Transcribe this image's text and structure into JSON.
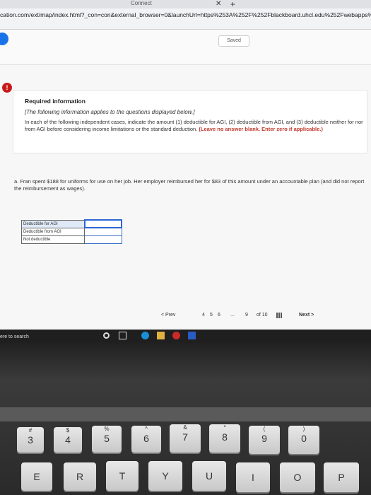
{
  "browser": {
    "tab_title": "Connect",
    "url": "cation.com/ext/map/index.html?_con=con&external_browser=0&launchUrl=https%253A%252F%252Fblackboard.uhcl.edu%252Fwebapps%"
  },
  "toolbar": {
    "saved_label": "Saved"
  },
  "info": {
    "alert_symbol": "!",
    "title": "Required information",
    "subtitle": "[The following information applies to the questions displayed below.]",
    "body": "In each of the following independent cases, indicate the amount (1) deductible for AGI, (2) deductible from AGI, and (3) deductible neither for nor from AGI before considering income limitations or the standard deduction.",
    "emphasis": "(Leave no answer blank. Enter zero if applicable.)"
  },
  "question": {
    "text": "a. Fran spent $188 for uniforms for use on her job. Her employer reimbursed her for $83 of this amount under an accountable plan (and did not report the reimbursement as wages)."
  },
  "answer_table": {
    "rows": [
      {
        "label": "Deductible for AGI",
        "value": ""
      },
      {
        "label": "Deductible from AGI",
        "value": ""
      },
      {
        "label": "Not deductible",
        "value": ""
      }
    ]
  },
  "pager": {
    "prev_label": "< Prev",
    "pages": [
      "4",
      "5",
      "6",
      "...",
      "9"
    ],
    "of_label": "of 10",
    "next_label": "Next >"
  },
  "taskbar": {
    "search_placeholder": "ere to search"
  },
  "keyboard": {
    "number_keys": [
      {
        "sym": "#",
        "main": "3"
      },
      {
        "sym": "$",
        "main": "4"
      },
      {
        "sym": "%",
        "main": "5"
      },
      {
        "sym": "^",
        "main": "6"
      },
      {
        "sym": "&",
        "main": "7"
      },
      {
        "sym": "*",
        "main": "8"
      },
      {
        "sym": "(",
        "main": "9"
      },
      {
        "sym": ")",
        "main": "0"
      }
    ],
    "letter_keys": [
      "E",
      "R",
      "T",
      "Y",
      "U",
      "I",
      "O",
      "P"
    ]
  },
  "colors": {
    "accent": "#2c66d4",
    "alert": "#c91a1a",
    "emphasis_text": "#c0392b"
  }
}
